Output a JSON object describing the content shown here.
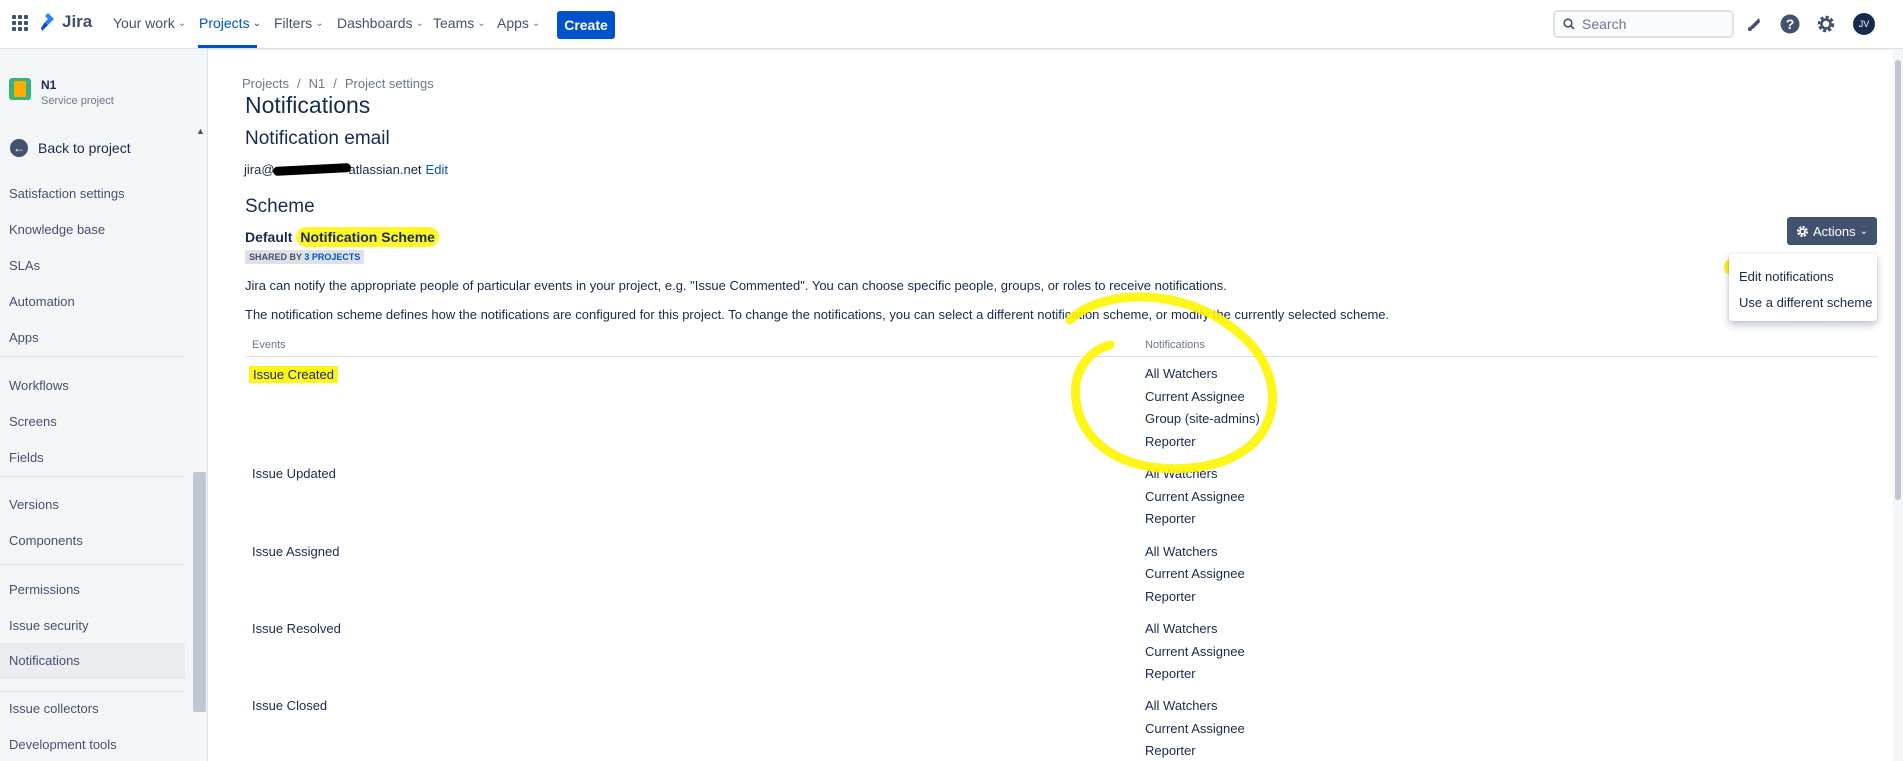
{
  "topnav": {
    "logo_text": "Jira",
    "items": [
      {
        "label": "Your work"
      },
      {
        "label": "Projects"
      },
      {
        "label": "Filters"
      },
      {
        "label": "Dashboards"
      },
      {
        "label": "Teams"
      },
      {
        "label": "Apps"
      }
    ],
    "create_label": "Create",
    "search_placeholder": "Search",
    "avatar_initials": "JV"
  },
  "sidebar": {
    "project_name": "N1",
    "project_type": "Service project",
    "back_label": "Back to project",
    "items": [
      "Satisfaction settings",
      "Knowledge base",
      "SLAs",
      "Automation",
      "Apps",
      "Workflows",
      "Screens",
      "Fields",
      "Versions",
      "Components",
      "Permissions",
      "Issue security",
      "Notifications",
      "Issue collectors",
      "Development tools"
    ]
  },
  "breadcrumb": [
    "Projects",
    "/",
    "N1",
    "/",
    "Project settings"
  ],
  "page_title": "Notifications",
  "email_section": {
    "heading": "Notification email",
    "address_prefix": "jira@",
    "address_suffix": "atlassian.net",
    "edit_label": "Edit"
  },
  "scheme": {
    "heading": "Scheme",
    "name_prefix": "Default ",
    "name_highlight": "Notification Scheme",
    "badge_prefix": "SHARED BY ",
    "badge_link": "3 PROJECTS",
    "desc1": "Jira can notify the appropriate people of particular events in your project, e.g. \"Issue Commented\". You can choose specific people, groups, or roles to receive notifications.",
    "desc2": "The notification scheme defines how the notifications are configured for this project. To change the notifications, you can select a different notification scheme, or modify the currently selected scheme."
  },
  "table": {
    "col_events": "Events",
    "col_notifications": "Notifications",
    "rows": [
      {
        "event": "Issue Created",
        "notifications": [
          "All Watchers",
          "Current Assignee",
          "Group (site-admins)",
          "Reporter"
        ]
      },
      {
        "event": "Issue Updated",
        "notifications": [
          "All Watchers",
          "Current Assignee",
          "Reporter"
        ]
      },
      {
        "event": "Issue Assigned",
        "notifications": [
          "All Watchers",
          "Current Assignee",
          "Reporter"
        ]
      },
      {
        "event": "Issue Resolved",
        "notifications": [
          "All Watchers",
          "Current Assignee",
          "Reporter"
        ]
      },
      {
        "event": "Issue Closed",
        "notifications": [
          "All Watchers",
          "Current Assignee",
          "Reporter"
        ]
      }
    ]
  },
  "actions": {
    "button_label": "Actions",
    "menu": [
      "Edit notifications",
      "Use a different scheme"
    ]
  },
  "colors": {
    "brand": "#0052cc",
    "highlight": "#fff500",
    "text": "#172b4d"
  }
}
